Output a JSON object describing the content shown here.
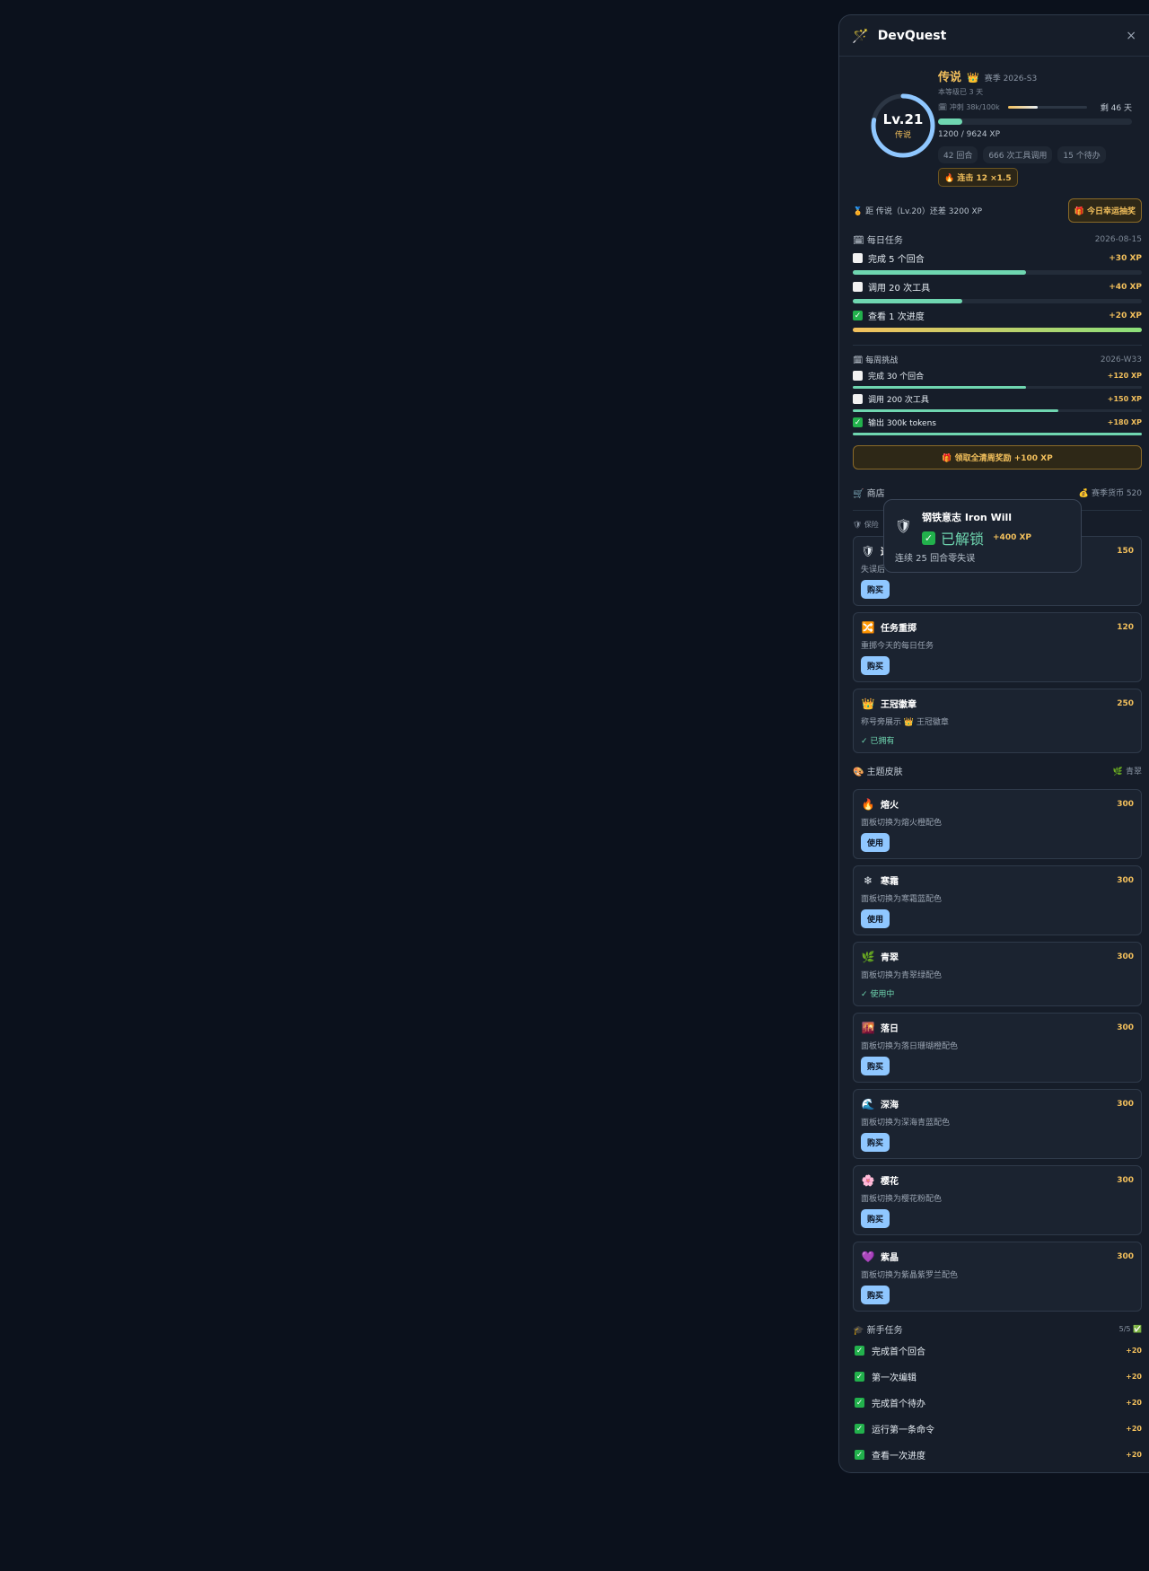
{
  "app": {
    "title": "DevQuest",
    "logo": "🪄",
    "close": "×"
  },
  "level": {
    "label": "Lv.21",
    "tier": "传说",
    "crown": "👑",
    "season": "赛季 2026-S3",
    "days_at_level": "本等级已 3 天",
    "sprint_label": "🗓 冲刺 38k/100k",
    "sprint_progress": 0.38,
    "days_left": "剩 46 天",
    "xp_text": "1200 / 9624 XP",
    "xp_progress": 0.125,
    "ring_progress": 0.78,
    "stats": [
      "42 回合",
      "666 次工具调用",
      "15 个待办"
    ],
    "streak": "🔥 连击 12 ×1.5"
  },
  "next": {
    "text": "🏅 距 传说（Lv.20）还差 3200 XP",
    "lucky_button": "🎁 今日幸运抽奖"
  },
  "daily": {
    "title": "🗓 每日任务",
    "date": "2026-08-15",
    "tasks": [
      {
        "label": "完成 5 个回合",
        "xp": "+30 XP",
        "done": false,
        "progress": 0.6
      },
      {
        "label": "调用 20 次工具",
        "xp": "+40 XP",
        "done": false,
        "progress": 0.38
      },
      {
        "label": "查看 1 次进度",
        "xp": "+20 XP",
        "done": true,
        "progress": 1.0
      }
    ]
  },
  "weekly": {
    "title": "🗓 每周挑战",
    "week": "2026-W33",
    "tasks": [
      {
        "label": "完成 30 个回合",
        "xp": "+120 XP",
        "done": false,
        "progress": 0.6
      },
      {
        "label": "调用 200 次工具",
        "xp": "+150 XP",
        "done": false,
        "progress": 0.71
      },
      {
        "label": "输出 300k tokens",
        "xp": "+180 XP",
        "done": true,
        "progress": 1.0
      }
    ],
    "claim_button": "🎁 领取全清周奖励 +100 XP"
  },
  "shop": {
    "title": "🛒 商店",
    "currency": "💰 赛季货币 520",
    "category": "🛡 保险",
    "items": [
      {
        "icon": "🛡",
        "name": "连",
        "price": "150",
        "desc": "失误后",
        "action": "购买",
        "owned": false
      },
      {
        "icon": "🔀",
        "name": "任务重掷",
        "price": "120",
        "desc": "重掷今天的每日任务",
        "action": "购买",
        "owned": false
      },
      {
        "icon": "👑",
        "name": "王冠徽章",
        "price": "250",
        "desc": "称号旁展示 👑 王冠徽章",
        "action": "✓ 已拥有",
        "owned": true
      }
    ]
  },
  "skins": {
    "title": "🎨 主题皮肤",
    "current": "🌿 青翠",
    "items": [
      {
        "icon": "🔥",
        "name": "熔火",
        "price": "300",
        "desc": "面板切换为熔火橙配色",
        "action": "使用",
        "status": false
      },
      {
        "icon": "❄",
        "name": "寒霜",
        "price": "300",
        "desc": "面板切换为寒霜蓝配色",
        "action": "使用",
        "status": false
      },
      {
        "icon": "🌿",
        "name": "青翠",
        "price": "300",
        "desc": "面板切换为青翠绿配色",
        "action": "✓ 使用中",
        "status": true
      },
      {
        "icon": "🌇",
        "name": "落日",
        "price": "300",
        "desc": "面板切换为落日珊瑚橙配色",
        "action": "购买",
        "status": false
      },
      {
        "icon": "🌊",
        "name": "深海",
        "price": "300",
        "desc": "面板切换为深海青蓝配色",
        "action": "购买",
        "status": false
      },
      {
        "icon": "🌸",
        "name": "樱花",
        "price": "300",
        "desc": "面板切换为樱花粉配色",
        "action": "购买",
        "status": false
      },
      {
        "icon": "💜",
        "name": "紫晶",
        "price": "300",
        "desc": "面板切换为紫晶紫罗兰配色",
        "action": "购买",
        "status": false
      }
    ]
  },
  "newbie": {
    "title": "🎓 新手任务",
    "count": "5/5 ✅",
    "tasks": [
      {
        "label": "完成首个回合",
        "xp": "+20"
      },
      {
        "label": "第一次编辑",
        "xp": "+20"
      },
      {
        "label": "完成首个待办",
        "xp": "+20"
      },
      {
        "label": "运行第一条命令",
        "xp": "+20"
      },
      {
        "label": "查看一次进度",
        "xp": "+20"
      }
    ]
  },
  "tooltip": {
    "icon": "🛡",
    "name": "钢铁意志 Iron Will",
    "status": "已解锁",
    "xp": "+400 XP",
    "desc": "连续 25 回合零失误"
  },
  "colors": {
    "accent": "#f3c05c",
    "progress": "#6fd6b0",
    "button": "#8fc7ff",
    "background": "#0b111c",
    "panel": "#161d29"
  }
}
